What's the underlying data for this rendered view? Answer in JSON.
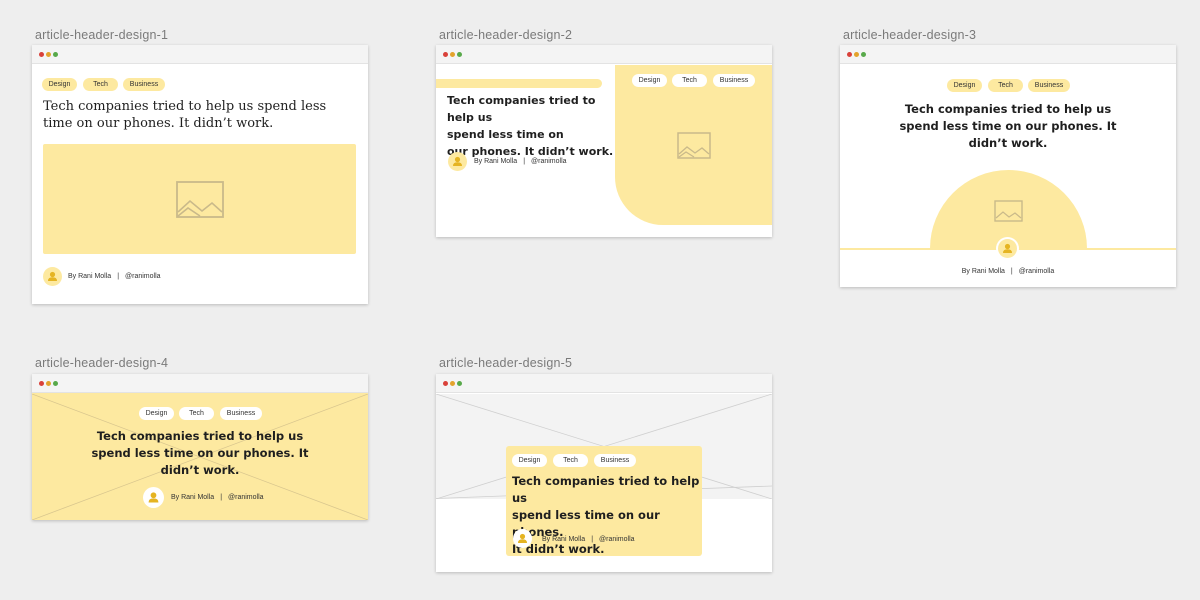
{
  "frames": [
    {
      "label": "article-header-design-1",
      "tags": [
        "Design",
        "Tech",
        "Business"
      ],
      "headline": [
        "Tech companies tried to help us spend less",
        "time on our phones. It didn’t work."
      ],
      "byline": {
        "author": "By Rani Molla",
        "handle": "@ranimolla"
      }
    },
    {
      "label": "article-header-design-2",
      "tags": [
        "Design",
        "Tech",
        "Business"
      ],
      "headline": [
        "Tech companies tried to help us",
        "spend less time on",
        "our phones. It didn’t work."
      ],
      "byline": {
        "author": "By Rani Molla",
        "handle": "@ranimolla"
      }
    },
    {
      "label": "article-header-design-3",
      "tags": [
        "Design",
        "Tech",
        "Business"
      ],
      "headline": [
        "Tech companies tried to help us",
        "spend less time on our phones. It",
        "didn’t work."
      ],
      "byline": {
        "author": "By Rani Molla",
        "handle": "@ranimolla"
      }
    },
    {
      "label": "article-header-design-4",
      "tags": [
        "Design",
        "Tech",
        "Business"
      ],
      "headline": [
        "Tech companies tried to help us",
        "spend less time on our phones. It",
        "didn’t work."
      ],
      "byline": {
        "author": "By Rani Molla",
        "handle": "@ranimolla"
      }
    },
    {
      "label": "article-header-design-5",
      "tags": [
        "Design",
        "Tech",
        "Business"
      ],
      "headline": [
        "Tech companies tried to help us",
        "spend less time on our phones.",
        "It didn’t work."
      ],
      "byline": {
        "author": "By Rani Molla",
        "handle": "@ranimolla"
      }
    }
  ],
  "icons": {
    "window_controls": [
      "close-dot",
      "minimize-dot",
      "zoom-dot"
    ],
    "image_placeholder": "image-placeholder-icon",
    "avatar": "person-icon"
  },
  "colors": {
    "background": "#eeeeee",
    "accent_yellow": "#fde9a0",
    "icon_yellow": "#e5b422",
    "placeholder_stroke": "#c9b98a",
    "text": "#1f1f1f",
    "label_gray": "#7a7a7a"
  }
}
